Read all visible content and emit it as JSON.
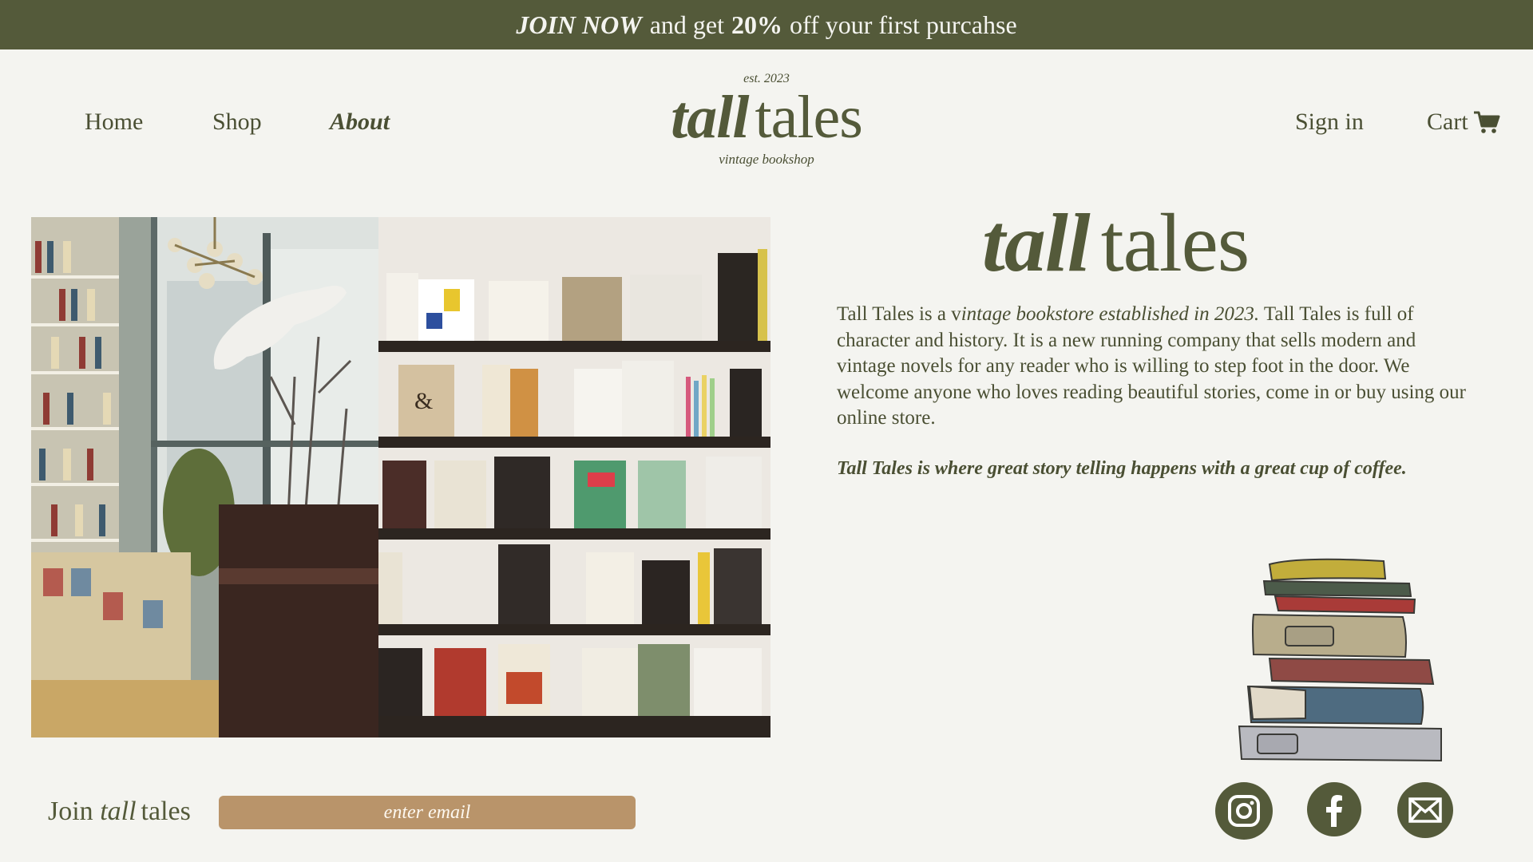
{
  "promo": {
    "join": "JOIN NOW",
    "mid": "and get",
    "percent": "20%",
    "end": "off your first purcahse"
  },
  "nav": {
    "home": "Home",
    "shop": "Shop",
    "about": "About"
  },
  "logo": {
    "est": "est. 2023",
    "tall": "tall",
    "tales": "tales",
    "sub": "vintage bookshop"
  },
  "account": {
    "signin": "Sign in",
    "cart": "Cart"
  },
  "hero": {
    "title_tall": "tall",
    "title_tales": "tales",
    "p1_a": "Tall Tales is a v",
    "p1_b": "intage bookstore established in 2023.",
    "p1_c": " Tall Tales is full of character and history. It is a new running company that sells modern and vintage novels for any reader who is willing to step foot in the door. We welcome anyone who loves reading beautiful stories, come in or buy using our online store.",
    "tagline": "Tall Tales is where great story telling happens with a great cup of coffee."
  },
  "footer": {
    "join_a": "Join",
    "join_b": "tall",
    "join_c": "tales",
    "email_placeholder": "enter email"
  },
  "icons": {
    "social": [
      "instagram-icon",
      "facebook-icon",
      "email-icon"
    ],
    "cart": "cart-icon"
  },
  "colors": {
    "olive": "#545a3a",
    "background": "#f4f4f0",
    "tan": "#b9946a"
  }
}
